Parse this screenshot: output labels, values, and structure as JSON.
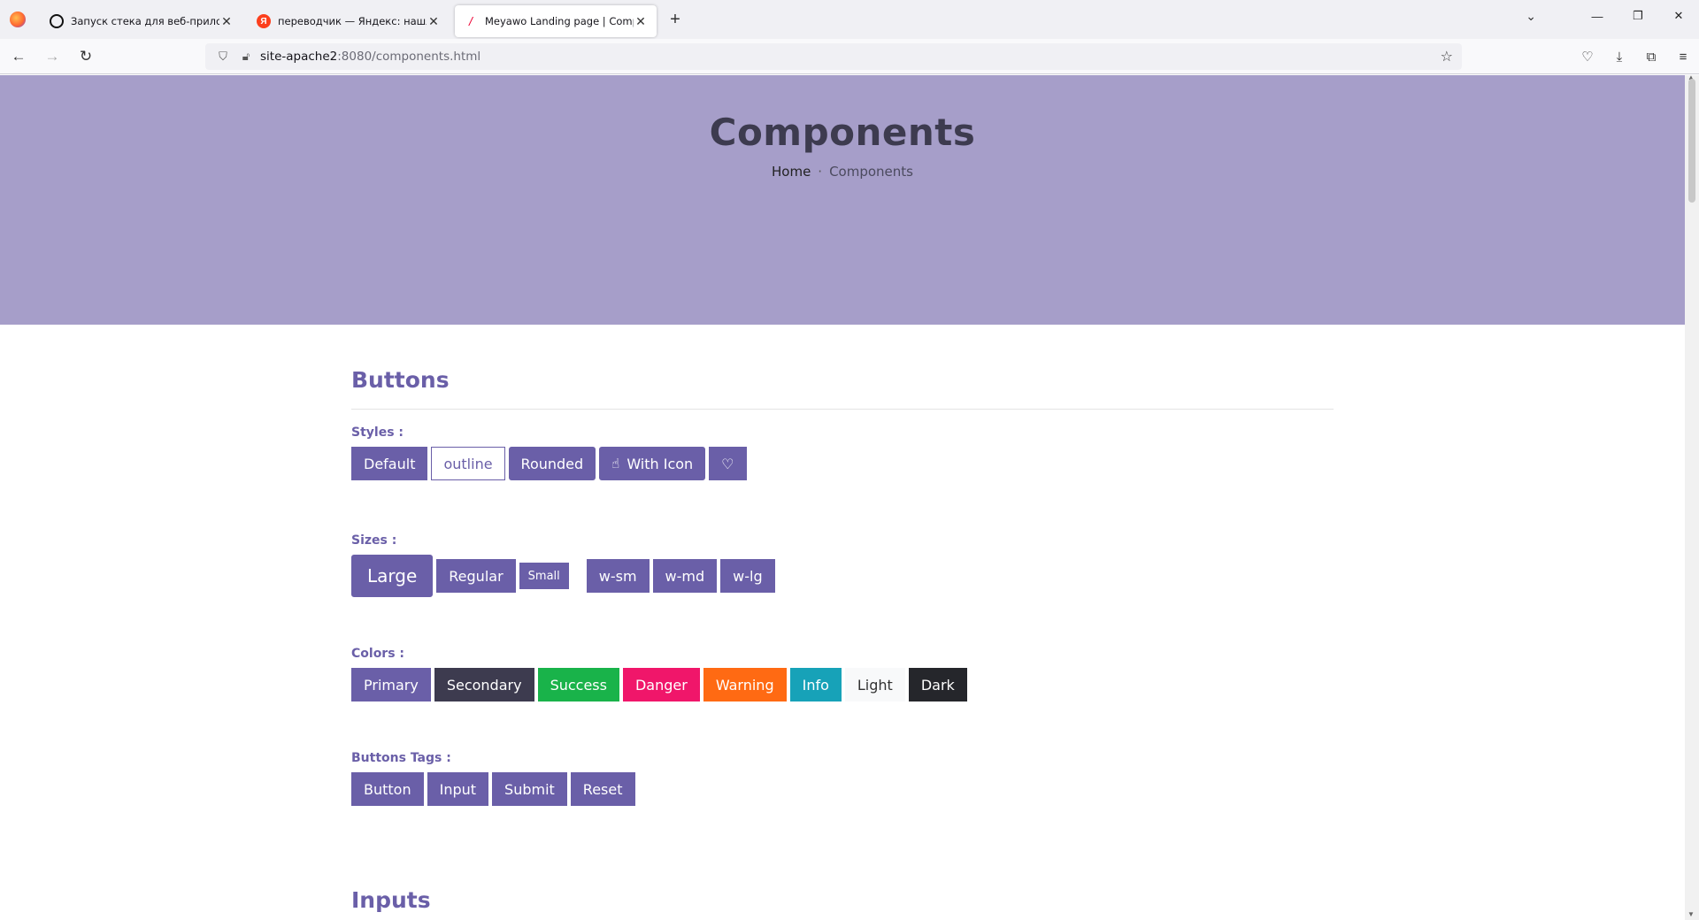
{
  "browser": {
    "tabs": [
      {
        "title": "Запуск стека для веб-приложен",
        "icon": "openai-icon",
        "active": false
      },
      {
        "title": "переводчик — Яндекс: нашлось",
        "icon": "yandex-icon",
        "active": false
      },
      {
        "title": "Meyawo Landing page | Compo",
        "icon": "meyawo-icon",
        "active": true
      }
    ],
    "url_host": "site-apache2",
    "url_rest": ":8080/components.html"
  },
  "hero": {
    "title": "Components",
    "breadcrumb_home": "Home",
    "breadcrumb_sep": "·",
    "breadcrumb_current": "Components"
  },
  "buttons_section": {
    "title": "Buttons",
    "styles_label": "Styles :",
    "styles": {
      "default": "Default",
      "outline": "outline",
      "rounded": "Rounded",
      "with_icon": "With Icon"
    },
    "sizes_label": "Sizes :",
    "sizes": {
      "large": "Large",
      "regular": "Regular",
      "small": "Small",
      "wsm": "w-sm",
      "wmd": "w-md",
      "wlg": "w-lg"
    },
    "colors_label": "Colors :",
    "colors": {
      "primary": "Primary",
      "secondary": "Secondary",
      "success": "Success",
      "danger": "Danger",
      "warning": "Warning",
      "info": "Info",
      "light": "Light",
      "dark": "Dark"
    },
    "tags_label": "Buttons Tags :",
    "tags": {
      "button": "Button",
      "input": "Input",
      "submit": "Submit",
      "reset": "Reset"
    }
  },
  "inputs_section": {
    "title": "Inputs"
  },
  "colors": {
    "primary": "#6a5fa8",
    "hero_bg": "#a69ec9",
    "success": "#19b34a",
    "danger": "#f0166a",
    "warning": "#ff6a13",
    "info": "#17a2b8"
  }
}
